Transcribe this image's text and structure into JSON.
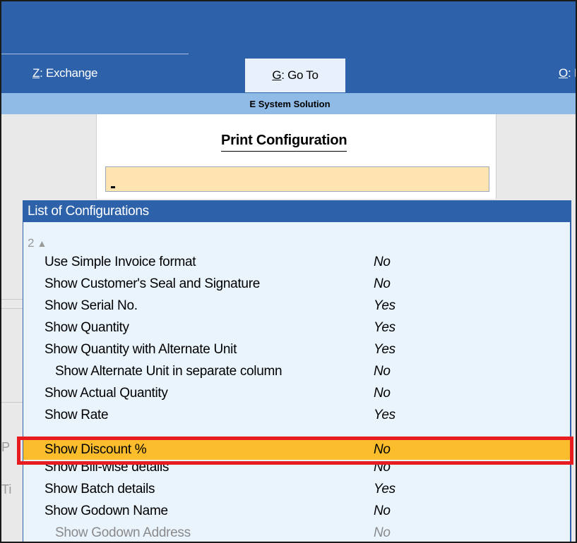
{
  "menu": {
    "exchange": {
      "key": "Z",
      "label": ": Exchange"
    },
    "goto": {
      "key": "G",
      "label": ": Go To"
    },
    "other": {
      "key": "O",
      "label": ": I"
    }
  },
  "company_name": "E System Solution",
  "print_config": {
    "title": "Print Configuration",
    "input_value": ""
  },
  "background_fragments": [
    "P",
    "Ti"
  ],
  "config_list": {
    "title": "List of Configurations",
    "page_indicator": "2",
    "items": [
      {
        "label": "Use Simple Invoice format",
        "value": "No"
      },
      {
        "label": "Show Customer's Seal and Signature",
        "value": "No"
      },
      {
        "label": "Show Serial No.",
        "value": "Yes"
      },
      {
        "label": "Show Quantity",
        "value": "Yes"
      },
      {
        "label": "Show Quantity with Alternate Unit",
        "value": "Yes"
      },
      {
        "label": "Show Alternate Unit in separate column",
        "value": "No"
      },
      {
        "label": "Show Actual Quantity",
        "value": "No"
      },
      {
        "label": "Show Rate",
        "value": "Yes"
      },
      {
        "label": "Show Discount %",
        "value": "No"
      },
      {
        "label": "Show Bill-wise details",
        "value": "No"
      },
      {
        "label": "Show Batch details",
        "value": "Yes"
      },
      {
        "label": "Show Godown Name",
        "value": "No"
      },
      {
        "label": "Show Godown Address",
        "value": "No"
      }
    ]
  },
  "colors": {
    "header_blue": "#2d62ab",
    "company_bar": "#8fbbe6",
    "highlight": "#fbbd2b",
    "annotation_red": "#e61c20",
    "input_bg": "#fde4b0"
  }
}
